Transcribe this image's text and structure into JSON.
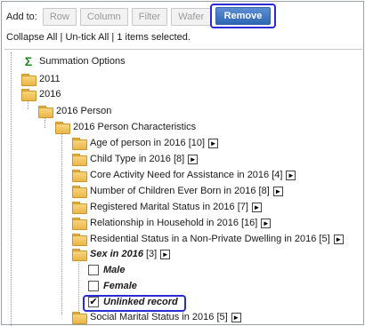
{
  "toolbar": {
    "add_to_label": "Add to:",
    "buttons": [
      "Row",
      "Column",
      "Filter",
      "Wafer"
    ],
    "remove_label": "Remove"
  },
  "status": {
    "collapse_all": "Collapse All",
    "separator": " | ",
    "untick_all": "Un-tick All",
    "selected_text": "1 items selected."
  },
  "tree": {
    "summation": "Summation Options",
    "y2011": "2011",
    "y2016": "2016",
    "person": "2016 Person",
    "person_chars": "2016 Person Characteristics",
    "items": [
      "Age of person in 2016 [10]",
      "Child Type in 2016 [8]",
      "Core Activity Need for Assistance in 2016 [4]",
      "Number of Children Ever Born in 2016 [8]",
      "Registered Marital Status in 2016 [7]",
      "Relationship in Household in 2016 [16]",
      "Residential Status in a Non-Private Dwelling in 2016 [5]"
    ],
    "sex_label": "Sex in 2016",
    "sex_count": "[3]",
    "sex_options": [
      {
        "label": "Male",
        "checked": false
      },
      {
        "label": "Female",
        "checked": false
      },
      {
        "label": "Unlinked record",
        "checked": true
      }
    ],
    "social": "Social Marital Status in 2016 [5]"
  },
  "icons": {
    "expand": "expand-arrow-icon",
    "folder": "folder-icon",
    "summation": "summation-icon",
    "check": "✔"
  },
  "colors": {
    "highlight": "#2b2bd6",
    "remove_button": "#3f75c0",
    "folder": "#eab64a",
    "summation": "#1e8a1e"
  }
}
